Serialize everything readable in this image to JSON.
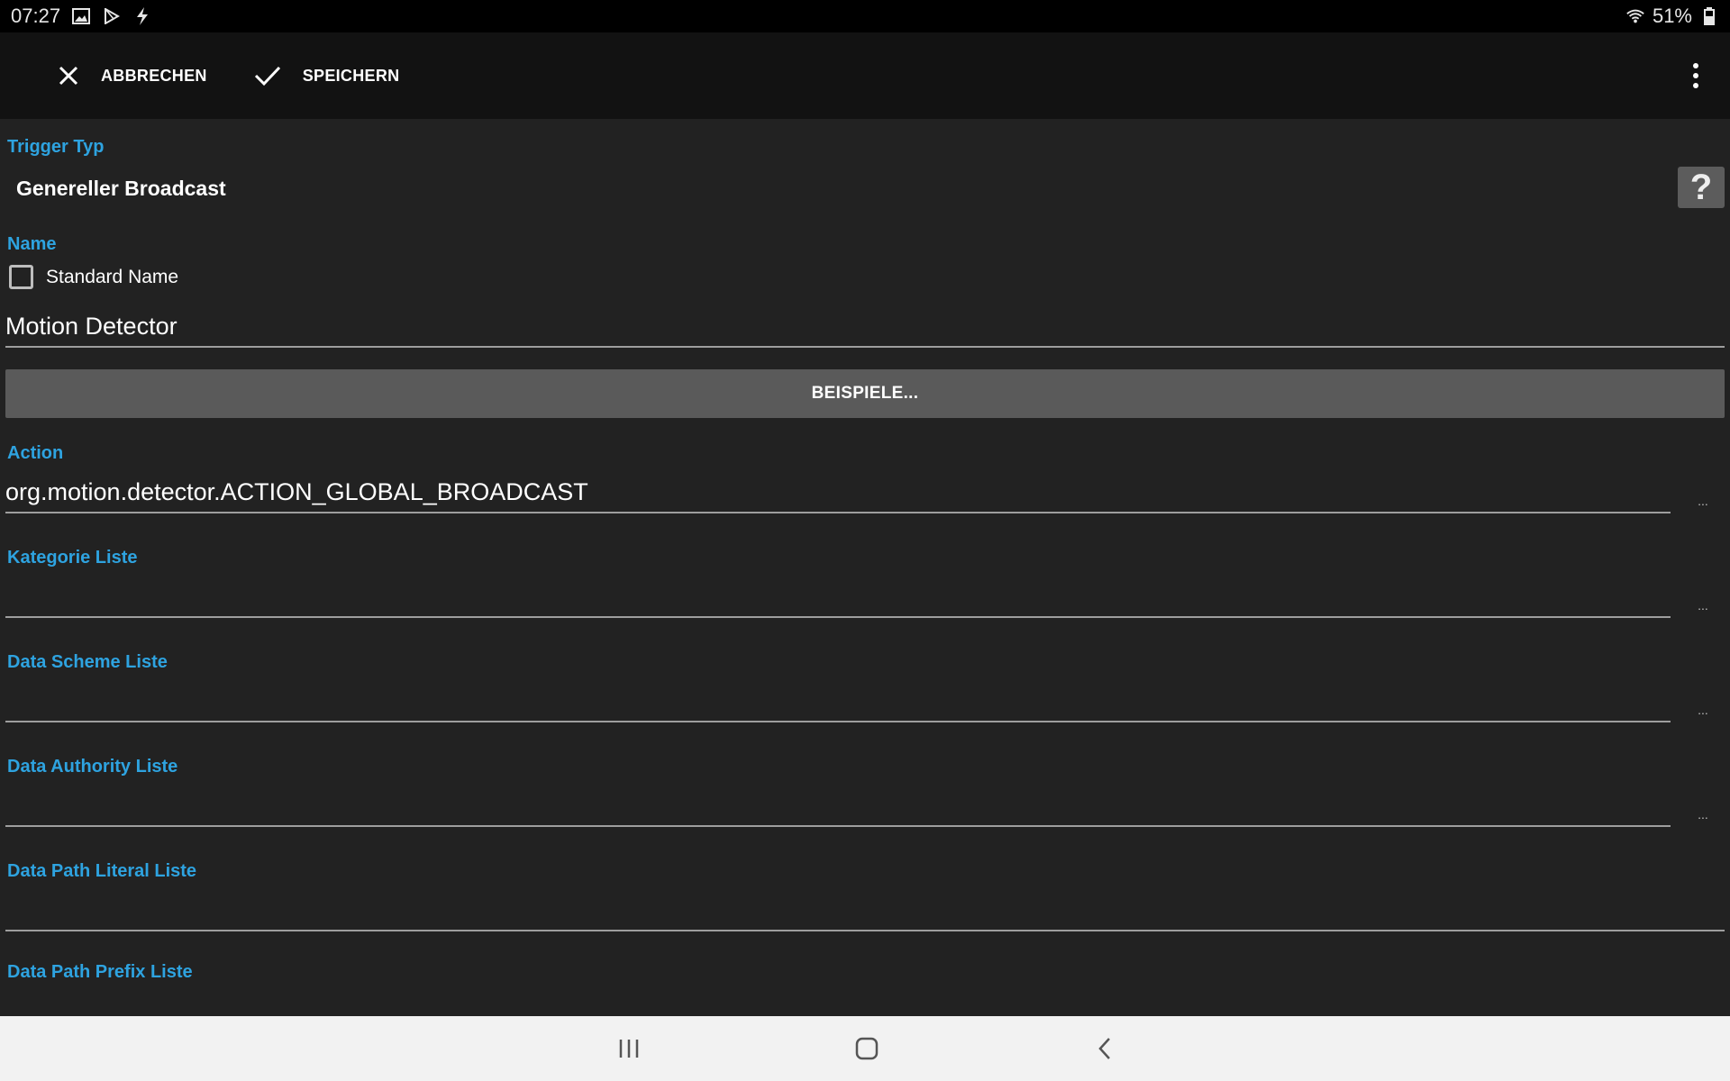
{
  "status_bar": {
    "time": "07:27",
    "icons": [
      "image-icon",
      "play-store-icon",
      "flash-icon"
    ],
    "battery": "51%",
    "wifi_icon": "wifi-icon",
    "battery_icon": "battery-icon"
  },
  "toolbar": {
    "cancel_label": "ABBRECHEN",
    "save_label": "SPEICHERN",
    "cancel_icon": "close-icon",
    "save_icon": "check-icon",
    "overflow_icon": "more-vert-icon"
  },
  "trigger": {
    "label": "Trigger Typ",
    "value": "Genereller Broadcast",
    "help": "?"
  },
  "name": {
    "label": "Name",
    "checkbox_label": "Standard Name",
    "checked": false,
    "value": "Motion Detector"
  },
  "examples_button": "BEISPIELE...",
  "action": {
    "label": "Action",
    "value": "org.motion.detector.ACTION_GLOBAL_BROADCAST",
    "ellipsis": "..."
  },
  "lists": [
    {
      "label": "Kategorie Liste",
      "value": "",
      "ellipsis": "..."
    },
    {
      "label": "Data Scheme Liste",
      "value": "",
      "ellipsis": "..."
    },
    {
      "label": "Data Authority Liste",
      "value": "",
      "ellipsis": "..."
    },
    {
      "label": "Data Path Literal Liste",
      "value": ""
    },
    {
      "label": "Data Path Prefix Liste"
    }
  ],
  "colors": {
    "accent": "#2ea3e0",
    "background": "#222222",
    "toolbar": "#121212",
    "button": "#5a5a5a"
  }
}
